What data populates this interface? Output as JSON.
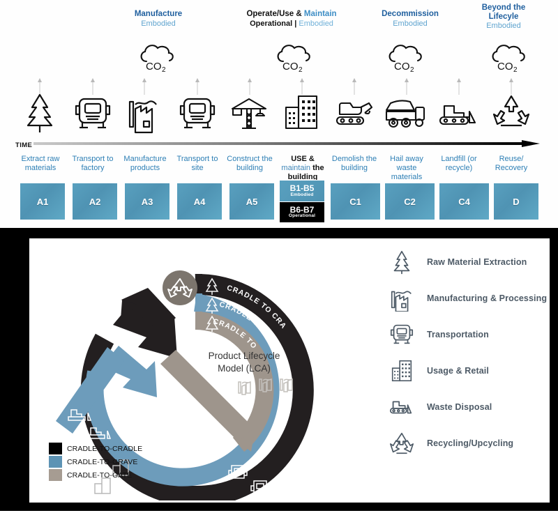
{
  "colors": {
    "blue_bar": "#4f93b3",
    "blue_text": "#2d7fb5",
    "title_blue": "#1f5f9e",
    "black": "#000000",
    "cradle_to_cradle": "#000000",
    "cradle_to_grave": "#6d9cbb",
    "cradle_to_gate": "#9e958c",
    "legend_icon_gray": "#4d5a66"
  },
  "timeline": {
    "time_axis_label": "TIME",
    "stage_heads": [
      {
        "title": "Manufacture",
        "sub": "Embodied",
        "title_parts": null
      },
      {
        "title": "Operate/Use & Maintain",
        "sub": "Operational | Embodied",
        "title_parts": [
          "Operate/Use &",
          "Maintain"
        ],
        "sub_parts": [
          "Operational",
          "|",
          "Embodied"
        ]
      },
      {
        "title": "Decommission",
        "sub": "Embodied",
        "title_parts": null
      },
      {
        "title": "Beyond the Lifecyle",
        "sub": "Embodied",
        "title_parts": null
      }
    ],
    "co2_icon_label": "CO",
    "co2_icon_sub": "2",
    "columns": [
      {
        "label": "Extract raw materials",
        "code": "A1",
        "icon": "tree-icon",
        "highlight": false
      },
      {
        "label": "Transport to factory",
        "code": "A2",
        "icon": "truck-icon",
        "highlight": false
      },
      {
        "label": "Manufacture products",
        "code": "A3",
        "icon": "factory-icon",
        "highlight": false
      },
      {
        "label": "Transport to site",
        "code": "A4",
        "icon": "truck-icon",
        "highlight": false
      },
      {
        "label": "Construct the building",
        "code": "A5",
        "icon": "crane-icon",
        "highlight": false
      },
      {
        "label": "USE & maintain the building",
        "code": "B1-B5",
        "code2": "B6-B7",
        "note": "Embodied",
        "note2": "Operational",
        "icon": "building-icon",
        "highlight": true
      },
      {
        "label": "Demolish the building",
        "code": "C1",
        "icon": "excavator-icon",
        "highlight": false
      },
      {
        "label": "Hail away waste materials",
        "code": "C2",
        "icon": "dump-truck-icon",
        "highlight": false
      },
      {
        "label": "Landfill (or recycle)",
        "code": "C4",
        "icon": "bulldozer-icon",
        "highlight": false
      },
      {
        "label": "Reuse/ Recovery",
        "code": "D",
        "icon": "recycle-icon",
        "highlight": false
      }
    ]
  },
  "lca": {
    "center_title_line1": "Product Lifecycle",
    "center_title_line2": "Model (LCA)",
    "ribbons": [
      {
        "label": "CRADLE TO CRADLE",
        "color": "#000000"
      },
      {
        "label": "CRADLE TO GRAVE",
        "color": "#6d9cbb"
      },
      {
        "label": "CRADLE TO GATE",
        "color": "#9e958c"
      }
    ],
    "swatch_legend": [
      {
        "label": "CRADLE-TO-CRADLE",
        "color": "#000000"
      },
      {
        "label": "CRADLE-TO-GRAVE",
        "color": "#5d93b4"
      },
      {
        "label": "CRADLE-TO-GATE",
        "color": "#a69c92"
      }
    ],
    "icon_legend": [
      {
        "label": "Raw Material Extraction",
        "icon": "tree-icon"
      },
      {
        "label": "Manufacturing & Processing",
        "icon": "factory-icon"
      },
      {
        "label": "Transportation",
        "icon": "truck-icon"
      },
      {
        "label": "Usage & Retail",
        "icon": "building-icon"
      },
      {
        "label": "Waste Disposal",
        "icon": "bulldozer-icon"
      },
      {
        "label": "Recycling/Upcycling",
        "icon": "recycle-icon"
      }
    ]
  }
}
